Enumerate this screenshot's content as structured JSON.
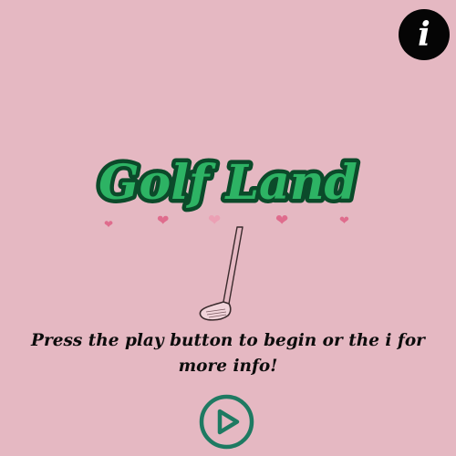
{
  "info_button": {
    "label": "i",
    "icon": "info-icon"
  },
  "title": {
    "text": "Golf Land",
    "fill_color": "#2db364",
    "outline_color": "#0b4a2a"
  },
  "decorations": {
    "hearts_color": "#df6c8d",
    "hearts_light_color": "#eba0b4",
    "club_icon": "golf-club-icon"
  },
  "instruction": {
    "text": "Press the play button to begin or the i for more info!"
  },
  "play_button": {
    "icon": "play-icon",
    "ring_color": "#1e7a62"
  },
  "colors": {
    "background": "#e5b8c2"
  }
}
